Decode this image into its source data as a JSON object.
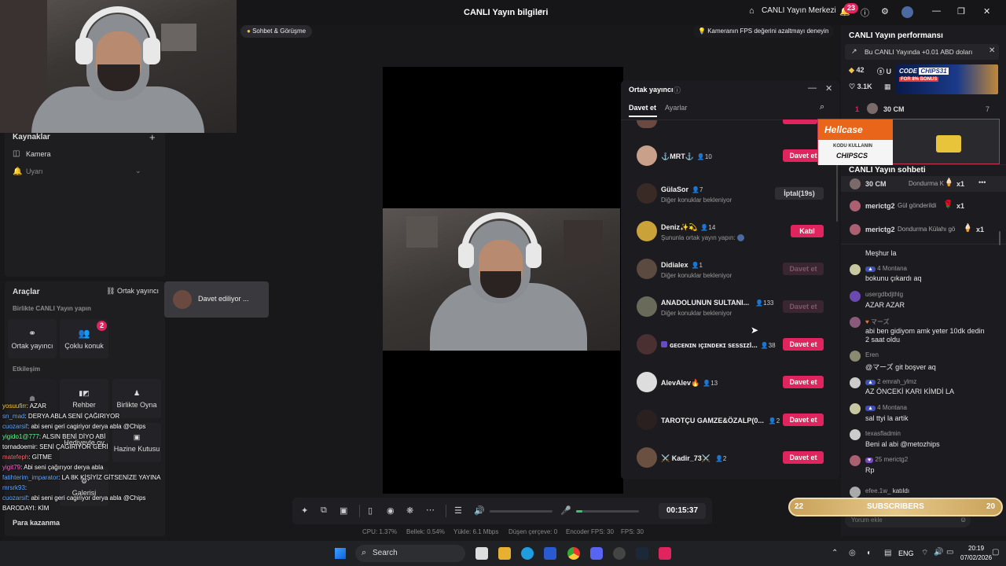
{
  "titlebar": {
    "title": "CANLI Yayın bilgileri",
    "center_link": "CANLI Yayın Merkezi",
    "notification_count": "23"
  },
  "pills": {
    "chat_meeting": "Sohbet & Görüşme",
    "fps_tip": "Kameranın FPS değerini azaltmayı deneyin"
  },
  "left": {
    "sources_title": "Kaynaklar",
    "camera_label": "Kamera",
    "alert_label": "Uyarı",
    "tools_title": "Araçlar",
    "cohost_link": "Ortak yayıncı",
    "together_title": "Birlikte CANLI Yayın yapın",
    "tool_cohost": "Ortak yayıncı",
    "tool_multi": "Çoklu konuk",
    "tool_multi_badge": "2",
    "interaction_title": "Etkileşim",
    "tile_guide": "Rehber",
    "tile_play": "Birlikte Oyna",
    "tile_gift": "Hediyeyle oy",
    "tile_treasure": "Hazine Kutusu",
    "tile_gallery": "Galerisi",
    "earn_title": "Para kazanma",
    "inviting_popup": "Davet ediliyor ..."
  },
  "chat_overlay": [
    {
      "user": "yosuufirr",
      "msg": ": AZAR",
      "color": "#ffcc33"
    },
    {
      "user": "sn_mad",
      "msg": ": DERYA ABLA SENİ ÇAĞIRIYOR",
      "color": "#66aaff"
    },
    {
      "user": "cuozarsif",
      "msg": ": abi seni geri cagiriyor derya abla @Chips",
      "color": "#66aaff"
    },
    {
      "user": "yigido1@777",
      "msg": ": ALSIN BENİ DİYO ABİ",
      "color": "#66ff99"
    },
    {
      "user": "tornadoemir",
      "msg": ": SENİ ÇAĞIRIYOR GERİ",
      "color": "#ffffff"
    },
    {
      "user": "matefeph",
      "msg": ": GİTME",
      "color": "#ff6666"
    },
    {
      "user": "yigit79",
      "msg": ": Abi seni çağırıyor derya abla",
      "color": "#ff66cc"
    },
    {
      "user": "fatihterim_imparator",
      "msg": ": LA 8K KİŞİYİZ GİTSENİZE YAYINA",
      "color": "#66aaff"
    },
    {
      "user": "mrsrk93",
      "msg": ":",
      "color": "#66aaff"
    },
    {
      "user": "cuozarsif",
      "msg": ": abi seni geri cagiriyor derya abla @Chips",
      "color": "#66aaff"
    },
    {
      "user": "BARODAYI",
      "msg": ": KİM",
      "color": "#ffffff"
    }
  ],
  "cohost_panel": {
    "title": "Ortak yayıncı",
    "tab_invite": "Davet et",
    "tab_settings": "Ayarlar",
    "rows": [
      {
        "name": "⚓MRT⚓",
        "count": "10",
        "sub": "",
        "btn": "Davet et",
        "state": "red",
        "avatar": "#c9a08a"
      },
      {
        "name": "GülaSor",
        "count": "7",
        "sub": "Diğer konuklar bekleniyor",
        "btn": "İptal(19s)",
        "state": "grey",
        "avatar": "#3a2a26"
      },
      {
        "name": "Deniz✨💫",
        "count": "14",
        "sub": "Şununla ortak yayın yapın:",
        "btn": "Katıl",
        "state": "red",
        "avatar": "#c9a23a"
      },
      {
        "name": "Didialex",
        "count": "1",
        "sub": "Diğer konuklar bekleniyor",
        "btn": "Davet et",
        "state": "dim",
        "avatar": "#5a4a40"
      },
      {
        "name": "ANADOLUNUN SULTANI...",
        "count": "133",
        "sub": "Diğer konuklar bekleniyor",
        "btn": "Davet et",
        "state": "dim",
        "avatar": "#6a6a5a"
      },
      {
        "name": "ɢᴇᴄᴇɴɪɴ ıçɪɴᴅᴇᴋɪ sᴇssɪᴢl...",
        "count": "38",
        "sub": "",
        "btn": "Davet et",
        "state": "red",
        "avatar": "#4a3030"
      },
      {
        "name": "AlevAlev🔥",
        "count": "13",
        "sub": "",
        "btn": "Davet et",
        "state": "red",
        "avatar": "#dddddd"
      },
      {
        "name": "TAROTÇU GAMZE&ÖZALP(0...",
        "count": "2",
        "sub": "",
        "btn": "Davet et",
        "state": "red",
        "avatar": "#2a2020"
      },
      {
        "name": "⚔️ Kadir_73⚔️",
        "count": "2",
        "sub": "",
        "btn": "Davet et",
        "state": "red",
        "avatar": "#6a5040"
      }
    ]
  },
  "right": {
    "perf_title": "CANLI Yayın performansı",
    "earn_notice": "Bu CANLI Yayında +0.01 ABD doları",
    "stat_diamonds": "42",
    "stat_u": "U",
    "stat_likes": "3.1K",
    "rank_no": "1",
    "rank_name": "30 CM",
    "rank_value": "7",
    "ad_code_title": "CODE",
    "ad_code": "CHIPS31",
    "ad_bonus": "FOR 8% BONUS",
    "hellcase_brand": "Hellcase",
    "hellcase_use": "KODU KULLANIN",
    "hellcase_code": "CHIPSCS",
    "chat_title": "CANLI Yayın sohbeti",
    "gifts": [
      {
        "user": "30 CM",
        "text": "Dondurma K",
        "qty": "x1"
      },
      {
        "user": "merictg2",
        "text": "Gül gönderildi",
        "qty": "x1"
      },
      {
        "user": "merictg2",
        "text": "Dondurma Külahı gö",
        "qty": "x1"
      }
    ],
    "chat": [
      {
        "user": "",
        "msg": "Meşhur la",
        "av": "#555"
      },
      {
        "user": "4 Montana",
        "msg": "bokunu çıkardı aq",
        "av": "#c8c8a0"
      },
      {
        "user": "usergdbdjthlg",
        "msg": "AZAR AZAR",
        "av": "#6a4ab0"
      },
      {
        "user": "マーズ",
        "msg": "abi ben gidiyom amk yeter 10dk dedin",
        "msg2": "2 saat oldu",
        "av": "#8a5a7a"
      },
      {
        "user": "Eren",
        "msg": "@マーズ git boşver aq",
        "av": "#8a8a70"
      },
      {
        "user": "2 emrah_ylmz",
        "msg": "AZ ÖNCEKİ KARI KİMDİ LA",
        "av": "#ccc"
      },
      {
        "user": "4 Montana",
        "msg": "sal ttyi la artik",
        "av": "#c8c8a0"
      },
      {
        "user": "texasfladmin",
        "msg": "Beni al abi @metozhips",
        "av": "#ccc"
      },
      {
        "user": "25 merictg2",
        "msg": "Rp",
        "av": "#aa6070"
      },
      {
        "user": "efee.1w_",
        "msg": "katıldı",
        "av": "#aaa"
      }
    ],
    "subs_left": "22",
    "subs_label": "SUBSCRIBERS",
    "subs_right": "20",
    "comment_placeholder": "Yorum ekle"
  },
  "controls": {
    "timer": "00:15:37"
  },
  "status": {
    "cpu": "CPU: 1.37%",
    "mem": "Bellek: 0.54%",
    "upload": "Yükle: 6.1 Mbps",
    "dropped": "Düşen çerçeve: 0",
    "encoder": "Encoder FPS: 30",
    "fps": "FPS: 30"
  },
  "taskbar": {
    "search": "Search",
    "lang": "ENG",
    "time": "20:19",
    "date": "07/02/2026"
  }
}
